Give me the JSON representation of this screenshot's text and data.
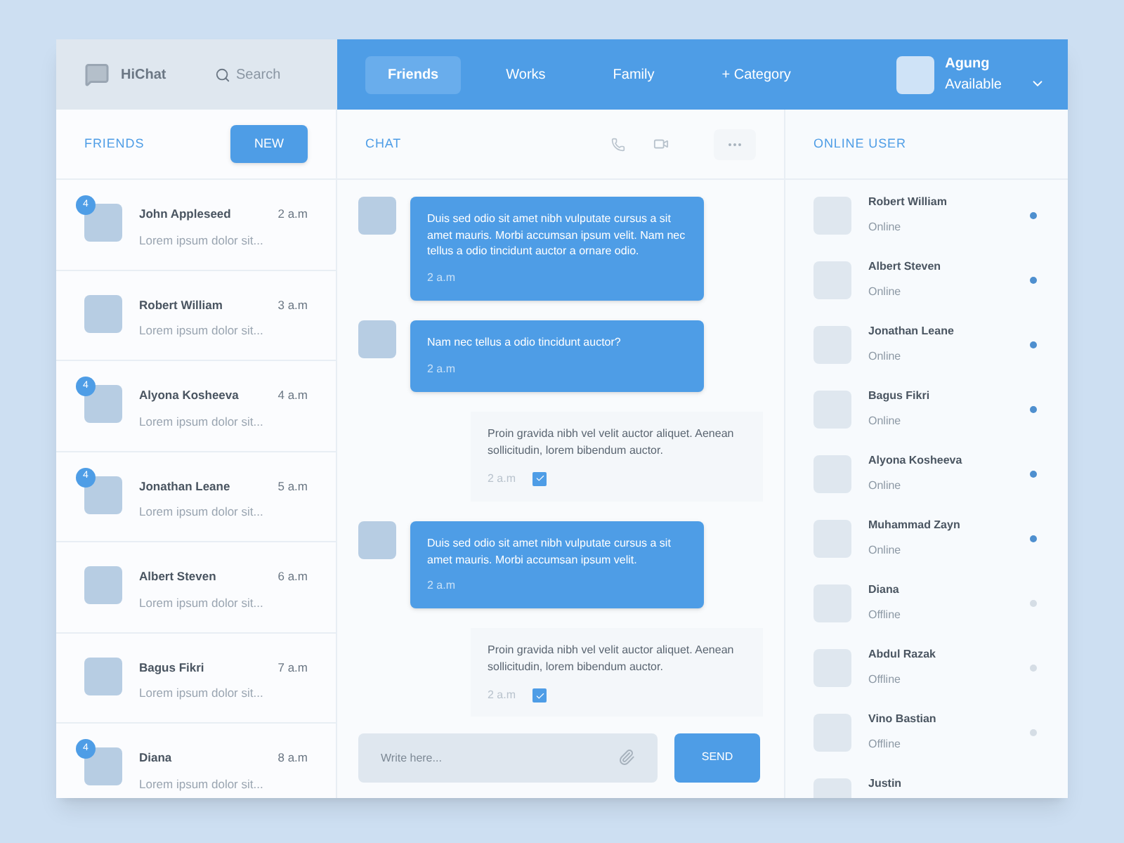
{
  "app": {
    "name": "HiChat"
  },
  "search": {
    "placeholder": "Search"
  },
  "tabs": [
    {
      "label": "Friends",
      "selected": true
    },
    {
      "label": "Works",
      "selected": false
    },
    {
      "label": "Family",
      "selected": false
    },
    {
      "label": "+ Category",
      "selected": false
    }
  ],
  "user": {
    "name": "Agung",
    "status": "Available"
  },
  "friends_panel": {
    "title": "FRIENDS",
    "new_button": "NEW"
  },
  "friends": [
    {
      "name": "John Appleseed",
      "time": "2 a.m",
      "preview": "Lorem ipsum dolor sit...",
      "badge": "4"
    },
    {
      "name": "Robert William",
      "time": "3 a.m",
      "preview": "Lorem ipsum dolor sit..."
    },
    {
      "name": "Alyona Kosheeva",
      "time": "4 a.m",
      "preview": "Lorem ipsum dolor sit...",
      "badge": "4"
    },
    {
      "name": "Jonathan Leane",
      "time": "5 a.m",
      "preview": "Lorem ipsum dolor sit...",
      "badge": "4"
    },
    {
      "name": "Albert Steven",
      "time": "6 a.m",
      "preview": "Lorem ipsum dolor sit..."
    },
    {
      "name": "Bagus Fikri",
      "time": "7 a.m",
      "preview": "Lorem ipsum dolor sit..."
    },
    {
      "name": "Diana",
      "time": "8 a.m",
      "preview": "Lorem ipsum dolor sit...",
      "badge": "4"
    }
  ],
  "chat": {
    "title": "CHAT",
    "messages": [
      {
        "kind": "incoming",
        "text": "Duis sed odio sit amet nibh vulputate cursus a sit amet mauris. Morbi accumsan ipsum velit. Nam nec tellus a odio tincidunt auctor a ornare odio.",
        "time": "2 a.m"
      },
      {
        "kind": "incoming",
        "text": "Nam nec tellus a odio tincidunt auctor?",
        "time": "2 a.m"
      },
      {
        "kind": "outgoing",
        "text": "Proin gravida nibh vel velit auctor aliquet. Aenean sollicitudin, lorem bibendum auctor.",
        "time": "2 a.m"
      },
      {
        "kind": "incoming",
        "text": "Duis sed odio sit amet nibh vulputate cursus a sit amet mauris. Morbi accumsan ipsum velit.",
        "time": "2 a.m"
      },
      {
        "kind": "outgoing",
        "text": "Proin gravida nibh vel velit auctor aliquet. Aenean sollicitudin, lorem bibendum auctor.",
        "time": "2 a.m"
      }
    ],
    "input": {
      "placeholder": "Write here..."
    },
    "send_button": "SEND"
  },
  "online_panel": {
    "title": "ONLINE USER"
  },
  "online_users": [
    {
      "name": "Robert William",
      "status": "Online",
      "online": true
    },
    {
      "name": "Albert Steven",
      "status": "Online",
      "online": true
    },
    {
      "name": "Jonathan Leane",
      "status": "Online",
      "online": true
    },
    {
      "name": "Bagus Fikri",
      "status": "Online",
      "online": true
    },
    {
      "name": "Alyona Kosheeva",
      "status": "Online",
      "online": true
    },
    {
      "name": "Muhammad Zayn",
      "status": "Online",
      "online": true
    },
    {
      "name": "Diana",
      "status": "Offline",
      "online": false
    },
    {
      "name": "Abdul Razak",
      "status": "Offline",
      "online": false
    },
    {
      "name": "Vino Bastian",
      "status": "Offline",
      "online": false
    },
    {
      "name": "Justin"
    }
  ]
}
